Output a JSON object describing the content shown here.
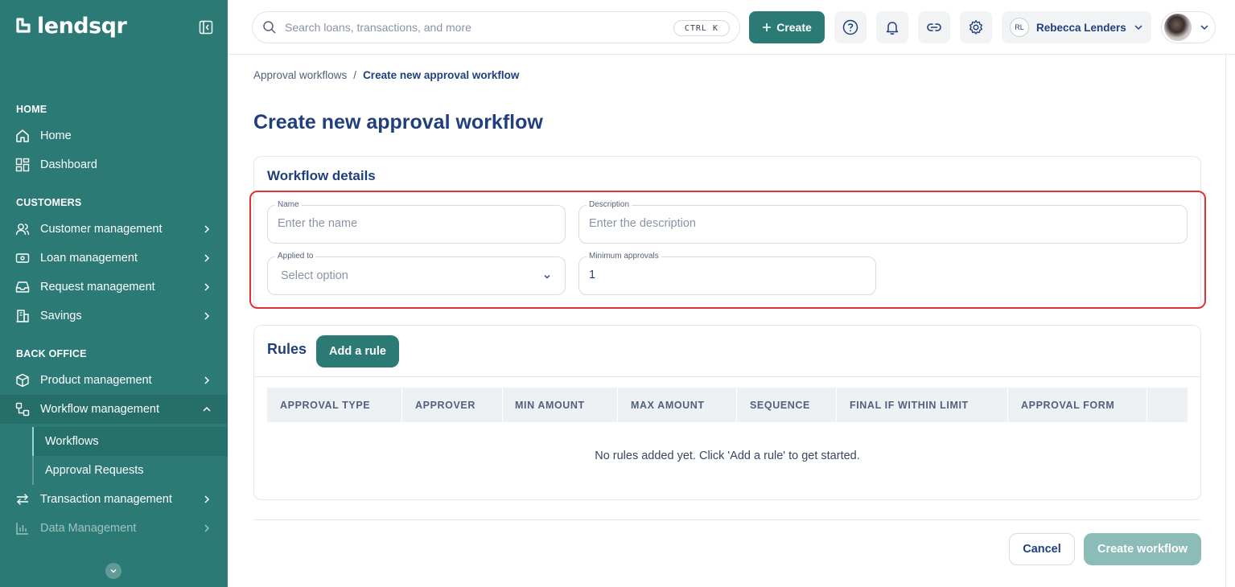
{
  "brand": {
    "name": "lendsqr",
    "accent": "#2b7a75",
    "highlight": "#e0303a"
  },
  "sidebar": {
    "sections": [
      {
        "title": "HOME",
        "items": [
          {
            "label": "Home",
            "icon": "home-icon"
          },
          {
            "label": "Dashboard",
            "icon": "dashboard-icon"
          }
        ]
      },
      {
        "title": "CUSTOMERS",
        "items": [
          {
            "label": "Customer management",
            "icon": "users-icon"
          },
          {
            "label": "Loan management",
            "icon": "loan-icon"
          },
          {
            "label": "Request management",
            "icon": "inbox-icon"
          },
          {
            "label": "Savings",
            "icon": "bank-icon"
          }
        ]
      },
      {
        "title": "BACK OFFICE",
        "items": [
          {
            "label": "Product management",
            "icon": "box-icon"
          },
          {
            "label": "Workflow management",
            "icon": "workflow-icon",
            "expanded": true,
            "children": [
              {
                "label": "Workflows",
                "active": true
              },
              {
                "label": "Approval Requests"
              }
            ]
          },
          {
            "label": "Transaction management",
            "icon": "transfer-icon"
          },
          {
            "label": "Data Management",
            "icon": "bar-chart-icon"
          }
        ]
      }
    ]
  },
  "header": {
    "search_placeholder": "Search loans, transactions, and more",
    "shortcut": "CTRL K",
    "create_label": "Create",
    "user_initials": "RL",
    "user_name": "Rebecca Lenders"
  },
  "breadcrumb": {
    "parent": "Approval workflows",
    "separator": "/",
    "current": "Create new approval workflow"
  },
  "page_title": "Create new approval workflow",
  "workflow_details": {
    "title": "Workflow details",
    "name": {
      "label": "Name",
      "placeholder": "Enter the name",
      "value": ""
    },
    "description": {
      "label": "Description",
      "placeholder": "Enter the description",
      "value": ""
    },
    "applied_to": {
      "label": "Applied to",
      "placeholder": "Select option"
    },
    "minimum_approvals": {
      "label": "Minimum approvals",
      "value": "1"
    }
  },
  "rules": {
    "title": "Rules",
    "add_label": "Add a rule",
    "columns": [
      "APPROVAL TYPE",
      "APPROVER",
      "MIN AMOUNT",
      "MAX AMOUNT",
      "SEQUENCE",
      "FINAL IF WITHIN LIMIT",
      "APPROVAL FORM"
    ],
    "empty_message": "No rules added yet. Click 'Add a rule' to get started."
  },
  "footer": {
    "cancel_label": "Cancel",
    "create_label": "Create workflow"
  }
}
